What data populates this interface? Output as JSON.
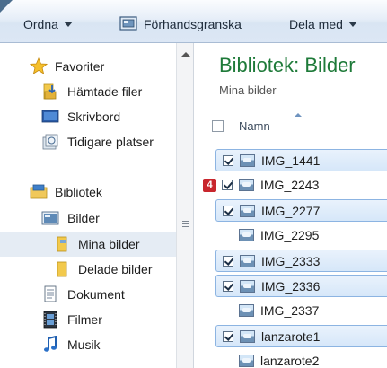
{
  "toolbar": {
    "organize_label": "Ordna",
    "preview_label": "Förhandsgranska",
    "share_label": "Dela med"
  },
  "nav": {
    "favorites": {
      "header": "Favoriter",
      "items": [
        "Hämtade filer",
        "Skrivbord",
        "Tidigare platser"
      ]
    },
    "libraries": {
      "header": "Bibliotek",
      "bilder": "Bilder",
      "sub_items": [
        "Mina bilder",
        "Delade bilder"
      ],
      "items": [
        "Dokument",
        "Filmer",
        "Musik"
      ]
    }
  },
  "content": {
    "title": "Bibliotek: Bilder",
    "subtitle": "Mina bilder",
    "column_name": "Namn",
    "files": [
      {
        "name": "IMG_1441",
        "selected": true
      },
      {
        "name": "IMG_2243",
        "selected": false
      },
      {
        "name": "IMG_2277",
        "selected": true
      },
      {
        "name": "IMG_2295",
        "selected": false
      },
      {
        "name": "IMG_2333",
        "selected": true
      },
      {
        "name": "IMG_2336",
        "selected": true
      },
      {
        "name": "IMG_2337",
        "selected": false
      },
      {
        "name": "lanzarote1",
        "selected": true
      },
      {
        "name": "lanzarote2",
        "selected": false
      }
    ]
  },
  "callout_badge": "4",
  "colors": {
    "title_green": "#1e7a39",
    "selection_blue": "#d6e7f9",
    "badge_red": "#c8262d"
  }
}
